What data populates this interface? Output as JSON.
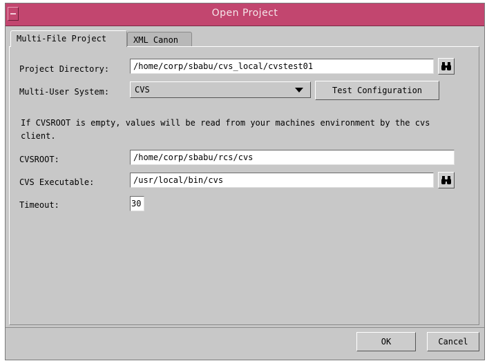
{
  "window": {
    "title": "Open Project"
  },
  "tabs": [
    {
      "label": "Multi-File Project"
    },
    {
      "label": "XML Canon"
    }
  ],
  "form": {
    "project_directory": {
      "label": "Project Directory:",
      "value": "/home/corp/sbabu/cvs_local/cvstest01"
    },
    "multi_user_system": {
      "label": "Multi-User System:",
      "selected": "CVS",
      "test_button": "Test Configuration"
    },
    "note": "If CVSROOT is empty, values will be read from your machines environment by the cvs client.",
    "cvsroot": {
      "label": "CVSROOT:",
      "value": "/home/corp/sbabu/rcs/cvs"
    },
    "cvs_executable": {
      "label": "CVS Executable:",
      "value": "/usr/local/bin/cvs"
    },
    "timeout": {
      "label": "Timeout:",
      "value": "30"
    }
  },
  "buttons": {
    "ok": "OK",
    "cancel": "Cancel"
  },
  "icons": {
    "browse": "binoculars-icon",
    "dropdown": "triangle-down-icon"
  },
  "colors": {
    "titlebar": "#c2466f",
    "window_bg": "#c8c8c8"
  }
}
